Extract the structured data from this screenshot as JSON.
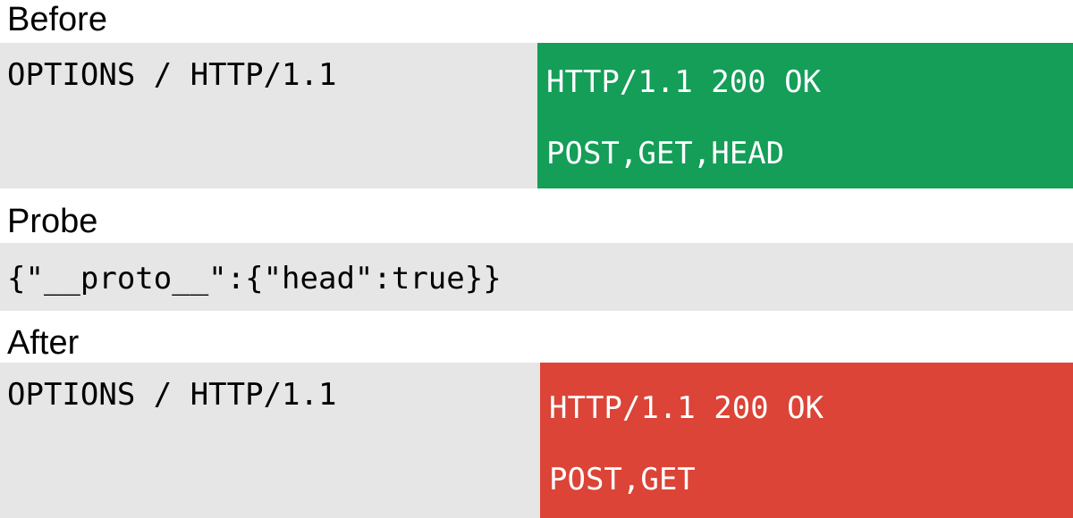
{
  "before": {
    "heading": "Before",
    "request": "OPTIONS / HTTP/1.1",
    "response": {
      "status": "HTTP/1.1 200 OK",
      "methods": "POST,GET,HEAD"
    }
  },
  "probe": {
    "heading": "Probe",
    "payload": "{\"__proto__\":{\"head\":true}}"
  },
  "after": {
    "heading": "After",
    "request": "OPTIONS / HTTP/1.1",
    "response": {
      "status": "HTTP/1.1 200 OK",
      "methods": "POST,GET"
    }
  },
  "colors": {
    "block_background": "#e6e6e6",
    "before_response": "#149e58",
    "after_response": "#db4437",
    "page_background": "#ffffff"
  }
}
